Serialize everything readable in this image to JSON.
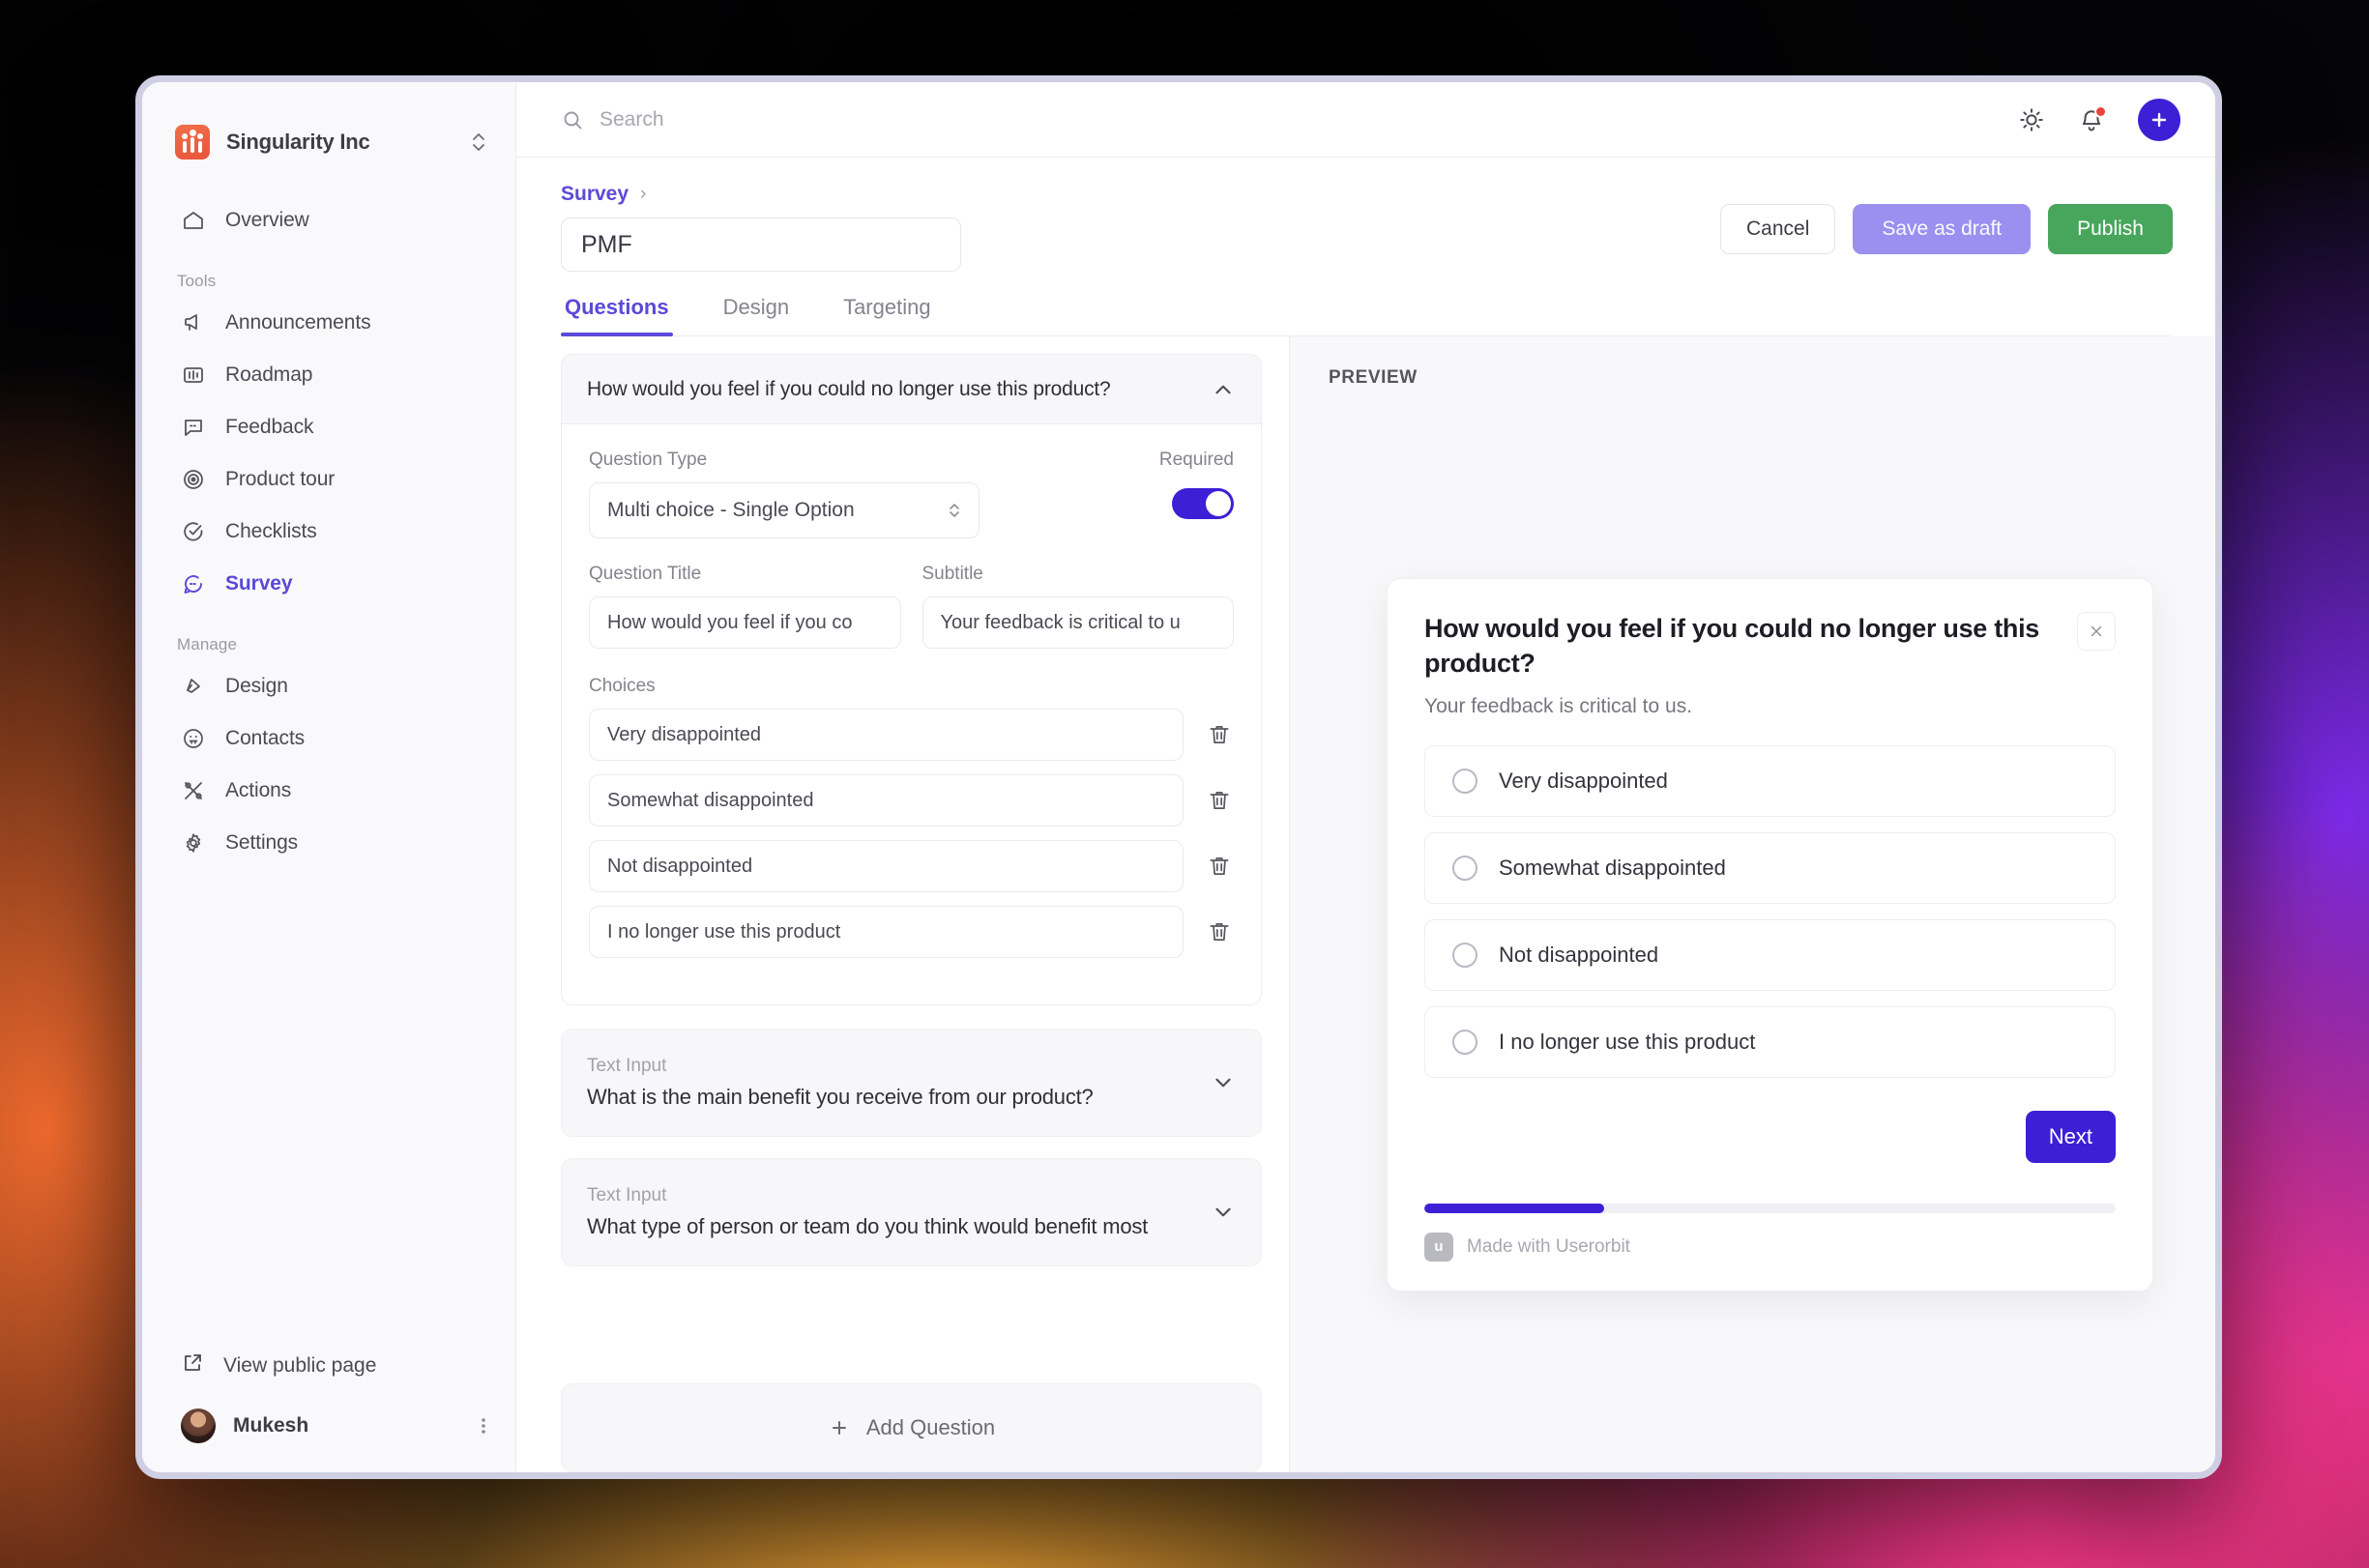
{
  "sidebar": {
    "org_name": "Singularity Inc",
    "org_switch_icon": "chevron-up-down-icon",
    "overview_label": "Overview",
    "sections": [
      {
        "label": "Tools",
        "items": [
          {
            "label": "Announcements",
            "icon": "megaphone-icon"
          },
          {
            "label": "Roadmap",
            "icon": "roadmap-icon"
          },
          {
            "label": "Feedback",
            "icon": "comment-icon"
          },
          {
            "label": "Product tour",
            "icon": "target-icon"
          },
          {
            "label": "Checklists",
            "icon": "check-circle-icon"
          },
          {
            "label": "Survey",
            "icon": "chat-icon"
          }
        ]
      },
      {
        "label": "Manage",
        "items": [
          {
            "label": "Design",
            "icon": "palette-icon"
          },
          {
            "label": "Contacts",
            "icon": "contacts-icon"
          },
          {
            "label": "Actions",
            "icon": "actions-icon"
          },
          {
            "label": "Settings",
            "icon": "gear-icon"
          }
        ]
      }
    ],
    "active_item": "Survey",
    "public_page_label": "View public page",
    "user_name": "Mukesh"
  },
  "topbar": {
    "search_placeholder": "Search",
    "search_value": "",
    "theme_icon": "sun-icon",
    "notifications_icon": "bell-icon",
    "add_icon": "plus-icon"
  },
  "header": {
    "breadcrumb": "Survey",
    "breadcrumb_chevron": "›",
    "survey_name": "PMF",
    "cancel_label": "Cancel",
    "save_draft_label": "Save as draft",
    "publish_label": "Publish"
  },
  "tabs": [
    {
      "label": "Questions",
      "active": true
    },
    {
      "label": "Design",
      "active": false
    },
    {
      "label": "Targeting",
      "active": false
    }
  ],
  "editor": {
    "expanded_question": {
      "header_text": "How would you feel if you could no longer use this product?",
      "question_type_label": "Question Type",
      "question_type_value": "Multi choice - Single Option",
      "required_label": "Required",
      "required_on": true,
      "question_title_label": "Question Title",
      "question_title_value": "How would you feel if you co",
      "subtitle_label": "Subtitle",
      "subtitle_value": "Your feedback is critical to u",
      "choices_label": "Choices",
      "choices": [
        "Very disappointed",
        "Somewhat disappointed",
        "Not disappointed",
        "I no longer use this product"
      ],
      "delete_icon": "trash-icon",
      "collapse_icon": "chevron-up-icon"
    },
    "collapsed_questions": [
      {
        "type": "Text Input",
        "text": "What is the main benefit you receive from our product?",
        "expand_icon": "chevron-down-icon"
      },
      {
        "type": "Text Input",
        "text": "What type of person or team do you think would benefit most",
        "expand_icon": "chevron-down-icon"
      }
    ],
    "add_question_label": "Add Question",
    "add_question_icon": "plus-icon"
  },
  "preview": {
    "label": "PREVIEW",
    "widget": {
      "title": "How would you feel if you could no longer use this product?",
      "subtitle": "Your feedback is critical to us.",
      "close_icon": "close-icon",
      "options": [
        "Very disappointed",
        "Somewhat disappointed",
        "Not disappointed",
        "I no longer use this product"
      ],
      "next_label": "Next",
      "progress_percent": 26,
      "footer_text": "Made with Userorbit",
      "footer_logo": "u"
    }
  },
  "colors": {
    "accent_purple": "#5b49d8",
    "primary_indigo": "#3d1fd6",
    "publish_green": "#47a65c",
    "draft_lavender": "#9b8ff0",
    "brand_orange": "#e8543a",
    "notification_red": "#e8443c"
  }
}
